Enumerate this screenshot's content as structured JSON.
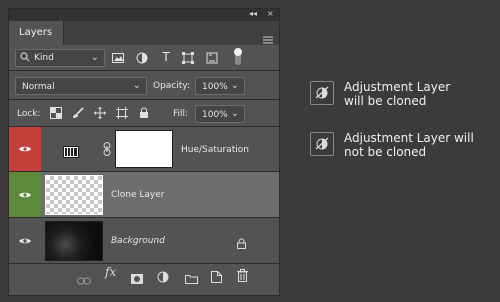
{
  "panel": {
    "tab_label": "Layers",
    "filter": {
      "value": "Kind"
    },
    "blend": {
      "value": "Normal"
    },
    "opacity": {
      "label": "Opacity:",
      "value": "100%"
    },
    "lock": {
      "label": "Lock:"
    },
    "fill": {
      "label": "Fill:",
      "value": "100%"
    }
  },
  "layers": [
    {
      "name": "Hue/Saturation",
      "type": "adjustment",
      "eye_color": "#c4403d"
    },
    {
      "name": "Clone Layer",
      "type": "pixel",
      "eye_color": "#5d8a3a"
    },
    {
      "name": "Background",
      "type": "background"
    }
  ],
  "legend": [
    {
      "text": "Adjustment Layer\nwill be cloned",
      "icon": "cloned-icon"
    },
    {
      "text": "Adjustment Layer will\nnot be cloned",
      "icon": "not-cloned-icon"
    }
  ],
  "colors": {
    "bg": "#3b3b3b",
    "panel": "#535353",
    "adjustment_eye": "#c4403d",
    "clone_eye": "#5d8a3a",
    "selected_row": "#6e6e6e"
  }
}
